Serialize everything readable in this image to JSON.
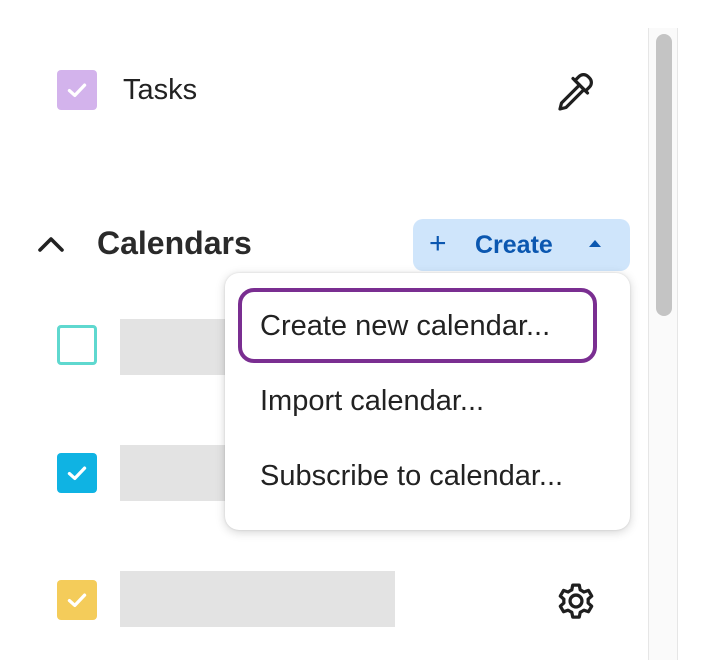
{
  "tasks_row": {
    "label": "Tasks",
    "checked": true,
    "color": "#d3b3ec",
    "action_icon": "eyedropper-icon"
  },
  "calendars_section": {
    "expand_icon": "chevron-up-icon",
    "title": "Calendars",
    "create_button": {
      "plus": "+",
      "label": "Create",
      "caret_icon": "caret-up-icon",
      "background": "#cfe5fb",
      "text_color": "#0b57b0"
    },
    "items": [
      {
        "checked": false,
        "color": "#5fd8cf"
      },
      {
        "checked": true,
        "color": "#0fb3e3"
      },
      {
        "checked": true,
        "color": "#f4cc5a",
        "action_icon": "gear-icon"
      }
    ]
  },
  "create_menu": {
    "items": [
      {
        "label": "Create new calendar...",
        "focused": true
      },
      {
        "label": "Import calendar...",
        "focused": false
      },
      {
        "label": "Subscribe to calendar...",
        "focused": false
      }
    ],
    "focus_color": "#7a2e91"
  }
}
